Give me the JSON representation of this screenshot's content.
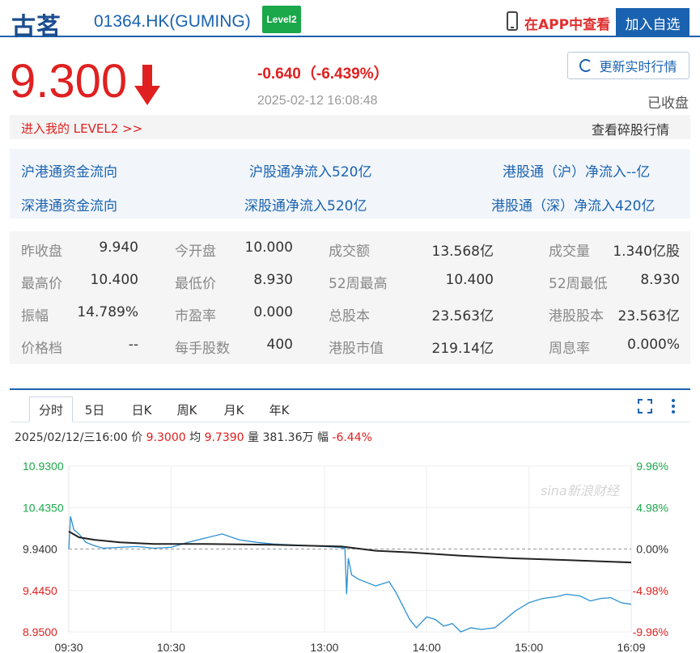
{
  "header": {
    "name": "古茗",
    "code": "01364.HK(GUMING)",
    "level2_badge": "Level2",
    "app_link": "在APP中查看",
    "add_button": "加入自选"
  },
  "quote": {
    "price": "9.300",
    "change": "-0.640（-6.439%）",
    "timestamp": "2025-02-12 16:08:48",
    "refresh_label": "更新实时行情",
    "status": "已收盘",
    "level2_link": "进入我的 LEVEL2 >>",
    "odd_lot_link": "查看碎股行情"
  },
  "flow": {
    "sh_title": "沪港通资金流向",
    "sh_net": "沪股通净流入520亿",
    "sh_hk": "港股通（沪）净流入--亿",
    "sz_title": "深港通资金流向",
    "sz_net": "深股通净流入520亿",
    "sz_hk": "港股通（深）净流入420亿"
  },
  "stats": [
    [
      {
        "label": "昨收盘",
        "value": "9.940"
      },
      {
        "label": "今开盘",
        "value": "10.000"
      },
      {
        "label": "成交额",
        "value": "13.568亿"
      },
      {
        "label": "成交量",
        "value": "1.340亿股"
      }
    ],
    [
      {
        "label": "最高价",
        "value": "10.400"
      },
      {
        "label": "最低价",
        "value": "8.930"
      },
      {
        "label": "52周最高",
        "value": "10.400"
      },
      {
        "label": "52周最低",
        "value": "8.930"
      }
    ],
    [
      {
        "label": "振幅",
        "value": "14.789%"
      },
      {
        "label": "市盈率",
        "value": "0.000"
      },
      {
        "label": "总股本",
        "value": "23.563亿"
      },
      {
        "label": "港股股本",
        "value": "23.563亿"
      }
    ],
    [
      {
        "label": "价格档",
        "value": "--"
      },
      {
        "label": "每手股数",
        "value": "400"
      },
      {
        "label": "港股市值",
        "value": "219.14亿"
      },
      {
        "label": "周息率",
        "value": "0.000%"
      }
    ]
  ],
  "chart_tabs": [
    "分时",
    "5日",
    "日K",
    "周K",
    "月K",
    "年K"
  ],
  "chart_info": {
    "datetime": "2025/02/12/三16:00",
    "price_label": "价",
    "price": "9.3000",
    "avg_label": "均",
    "avg": "9.7390",
    "vol_label": "量",
    "vol": "381.36万",
    "amp_label": "幅",
    "amp": "-6.44%"
  },
  "watermark": "sina新浪财经",
  "colors": {
    "up": "#e02020",
    "down": "#1aa84a",
    "brand": "#1a62b0",
    "price_line": "#2a8fd0",
    "avg_line": "#222222"
  },
  "chart_data": {
    "type": "line",
    "title": "",
    "y_left_ticks": [
      "10.9300",
      "10.4350",
      "9.9400",
      "9.4450",
      "8.9500"
    ],
    "y_right_ticks": [
      "9.96%",
      "4.98%",
      "0.00%",
      "-4.98%",
      "-9.96%"
    ],
    "x_ticks": [
      "09:30",
      "10:30",
      "13:00",
      "14:00",
      "15:00",
      "16:09"
    ],
    "ylim": [
      8.95,
      10.93
    ],
    "prev_close": 9.94,
    "series": [
      {
        "name": "价",
        "values": [
          [
            0,
            9.94
          ],
          [
            1,
            10.33
          ],
          [
            3,
            10.17
          ],
          [
            6,
            10.12
          ],
          [
            10,
            10.02
          ],
          [
            15,
            9.98
          ],
          [
            20,
            9.95
          ],
          [
            30,
            9.96
          ],
          [
            40,
            9.97
          ],
          [
            50,
            9.95
          ],
          [
            60,
            9.96
          ],
          [
            70,
            10.02
          ],
          [
            80,
            10.07
          ],
          [
            90,
            10.12
          ],
          [
            100,
            10.05
          ],
          [
            110,
            10.02
          ],
          [
            120,
            10.0
          ],
          [
            130,
            9.99
          ],
          [
            140,
            9.98
          ],
          [
            150,
            9.97
          ],
          [
            158,
            9.96
          ],
          [
            162,
            9.95
          ],
          [
            163,
            9.4
          ],
          [
            164,
            9.83
          ],
          [
            166,
            9.63
          ],
          [
            170,
            9.58
          ],
          [
            180,
            9.5
          ],
          [
            188,
            9.55
          ],
          [
            192,
            9.42
          ],
          [
            200,
            9.1
          ],
          [
            204,
            9.0
          ],
          [
            210,
            9.13
          ],
          [
            215,
            9.1
          ],
          [
            220,
            9.02
          ],
          [
            225,
            9.05
          ],
          [
            230,
            8.95
          ],
          [
            236,
            9.0
          ],
          [
            242,
            8.98
          ],
          [
            250,
            9.0
          ],
          [
            256,
            9.1
          ],
          [
            262,
            9.2
          ],
          [
            270,
            9.3
          ],
          [
            278,
            9.35
          ],
          [
            286,
            9.37
          ],
          [
            292,
            9.4
          ],
          [
            300,
            9.38
          ],
          [
            306,
            9.32
          ],
          [
            312,
            9.35
          ],
          [
            318,
            9.36
          ],
          [
            324,
            9.3
          ],
          [
            330,
            9.28
          ]
        ]
      },
      {
        "name": "均",
        "values": [
          [
            0,
            10.15
          ],
          [
            6,
            10.08
          ],
          [
            15,
            10.05
          ],
          [
            30,
            10.02
          ],
          [
            50,
            10.0
          ],
          [
            80,
            10.0
          ],
          [
            120,
            9.99
          ],
          [
            160,
            9.97
          ],
          [
            180,
            9.92
          ],
          [
            200,
            9.9
          ],
          [
            230,
            9.86
          ],
          [
            260,
            9.83
          ],
          [
            290,
            9.81
          ],
          [
            330,
            9.78
          ]
        ]
      }
    ]
  }
}
